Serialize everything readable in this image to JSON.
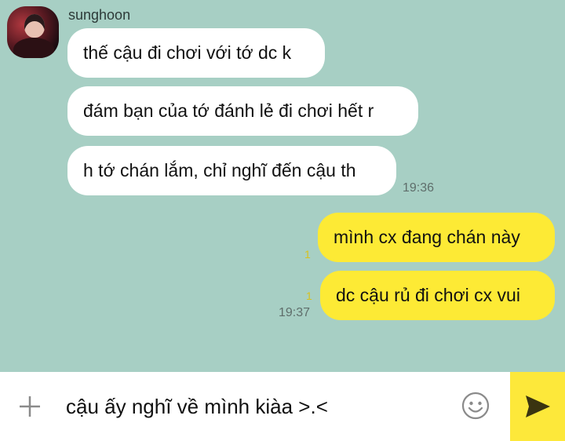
{
  "chat": {
    "sender_name": "sunghoon",
    "incoming": [
      {
        "text": "thế cậu đi chơi với tớ dc k"
      },
      {
        "text": "đám bạn của tớ đánh lẻ đi chơi hết r"
      },
      {
        "text": "h tớ chán lắm, chỉ nghĩ đến cậu th"
      }
    ],
    "incoming_time": "19:36",
    "outgoing": [
      {
        "text": "mình cx đang chán này",
        "unread": "1"
      },
      {
        "text": "dc cậu rủ đi chơi cx vui",
        "unread": "1"
      }
    ],
    "outgoing_time": "19:37"
  },
  "input": {
    "value": "cậu ấy nghĩ về mình kiàa >.<"
  },
  "icons": {
    "attach": "plus-icon",
    "emoji": "emoji-icon",
    "send": "send-icon"
  },
  "colors": {
    "background": "#a7cfc4",
    "incoming_bubble": "#ffffff",
    "outgoing_bubble": "#fdea35",
    "send_button": "#fde83a",
    "unread_count": "#d8c21d"
  }
}
